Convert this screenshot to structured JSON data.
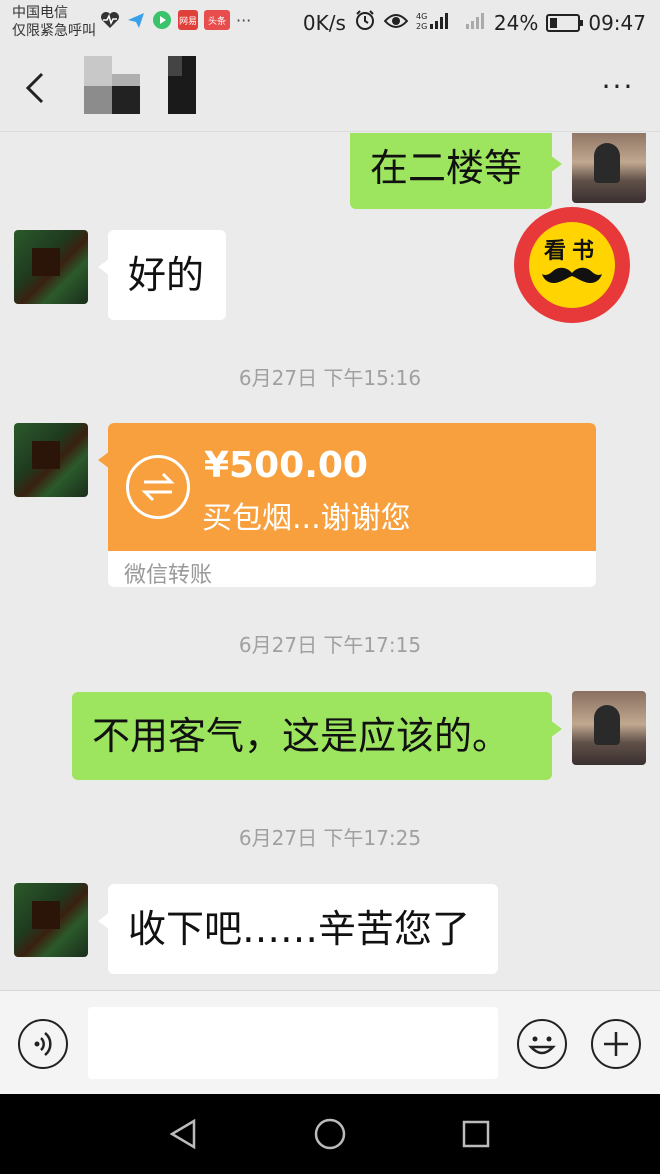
{
  "status_bar": {
    "carrier_line1": "中国电信",
    "carrier_line2": "仅限紧急呼叫",
    "app_icons": [
      "heartbeat-icon",
      "paper-plane-icon",
      "video-icon",
      "netease-icon",
      "toutiao-icon"
    ],
    "netease_label": "网易",
    "toutiao_label": "头条",
    "more_label": "···",
    "net_speed": "0K/s",
    "network_label": "4G\n2G",
    "battery": "24%",
    "battery_level": 0.24,
    "time": "09:47"
  },
  "header": {
    "back_icon": "chevron-left-icon",
    "more_label": "···"
  },
  "messages": {
    "m1": "在二楼等",
    "m2": "好的",
    "t1": "6月27日 下午15:16",
    "transfer_amount": "¥500.00",
    "transfer_note": "买包烟...谢谢您",
    "transfer_label": "微信转账",
    "t2": "6月27日 下午17:15",
    "m3": "不用客气，这是应该的。",
    "t3": "6月27日 下午17:25",
    "m4": "收下吧……辛苦您了"
  },
  "badge": {
    "text": "看书"
  },
  "input_bar": {
    "value": "",
    "placeholder": ""
  },
  "colors": {
    "sent_bubble": "#9de55f",
    "received_bubble": "#ffffff",
    "transfer": "#f8a03d",
    "background": "#ebebeb"
  }
}
